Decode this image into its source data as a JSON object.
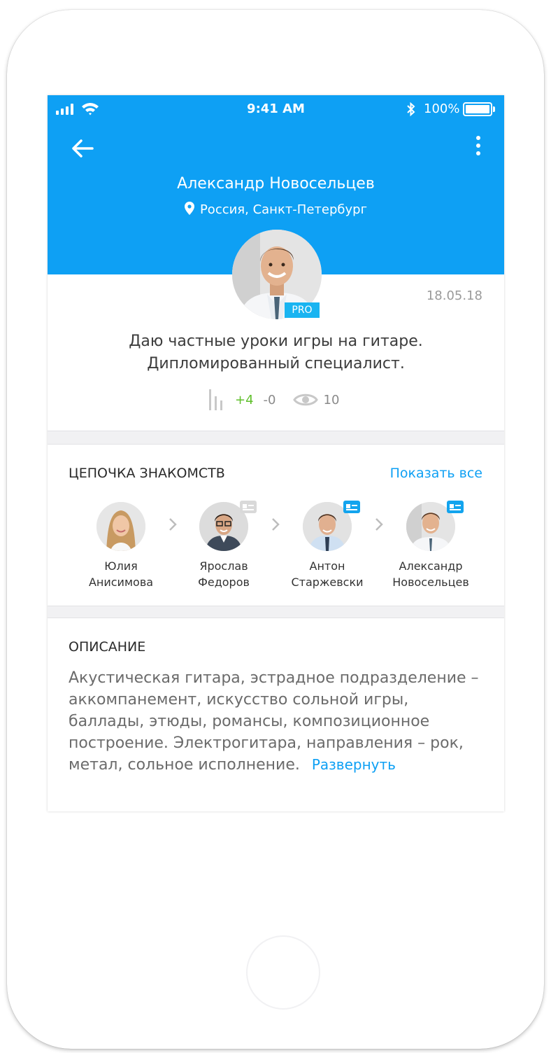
{
  "status_bar": {
    "time": "9:41 AM",
    "battery": "100%"
  },
  "header": {
    "name": "Александр Новосельцев",
    "location": "Россия, Санкт-Петербург",
    "colors": {
      "primary": "#0ea0f4",
      "pro_badge": "#19b4f1"
    }
  },
  "profile": {
    "badge": "PRO",
    "date": "18.05.18",
    "bio_line1": "Даю частные уроки игры на гитаре.",
    "bio_line2": "Дипломированный специалист.",
    "rating_up": "+4",
    "rating_down": "-0",
    "views": "10"
  },
  "chain": {
    "title": "ЦЕПОЧКА ЗНАКОМСТВ",
    "show_all": "Показать все",
    "people": [
      {
        "first": "Юлия",
        "last": "Анисимова"
      },
      {
        "first": "Ярослав",
        "last": "Федоров"
      },
      {
        "first": "Антон",
        "last": "Старжевски"
      },
      {
        "first": "Александр",
        "last": "Новосельцев"
      }
    ]
  },
  "description": {
    "title": "ОПИСАНИЕ",
    "text": "Акустическая гитара, эстрадное подразделение – аккомпанемент, искусство сольной игры, баллады, этюды, романсы, композиционное построение. Электрогитара, направления – рок, метал, сольное исполнение.",
    "expand": "Развернуть"
  }
}
